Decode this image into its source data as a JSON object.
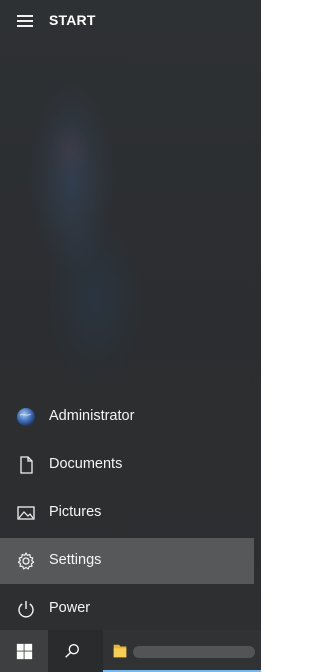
{
  "start_menu": {
    "title": "START",
    "items": [
      {
        "label": "Administrator",
        "icon": "user-avatar-icon"
      },
      {
        "label": "Documents",
        "icon": "document-icon"
      },
      {
        "label": "Pictures",
        "icon": "pictures-icon"
      },
      {
        "label": "Settings",
        "icon": "gear-icon",
        "selected": true
      },
      {
        "label": "Power",
        "icon": "power-icon"
      }
    ]
  },
  "taskbar": {
    "start_button_icon": "windows-logo-icon",
    "search_icon": "search-icon",
    "pinned_app_icon": "file-explorer-icon",
    "accent_color": "#76b9ed"
  }
}
